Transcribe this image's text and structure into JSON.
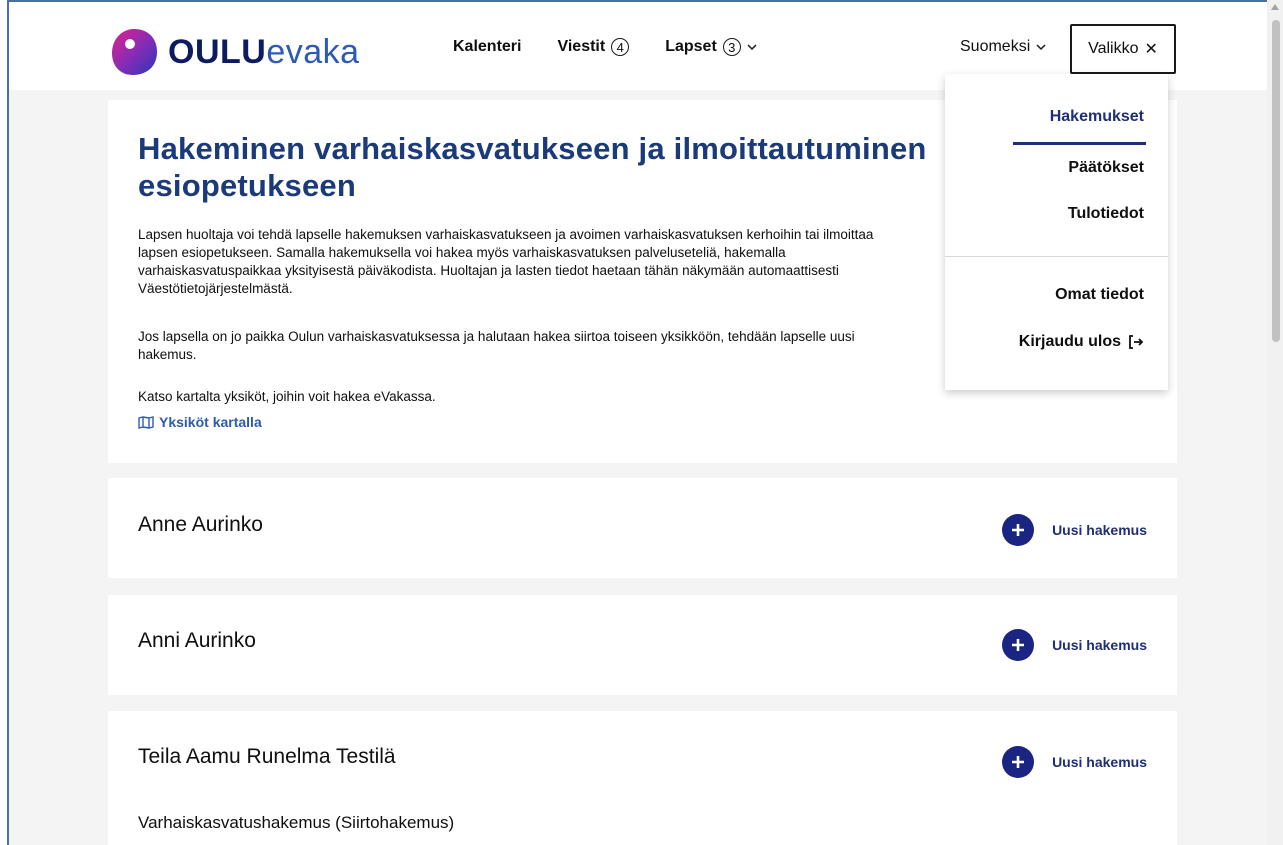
{
  "brand": {
    "part1": "OULU",
    "part2": "evaka"
  },
  "nav": {
    "calendar": "Kalenteri",
    "messages": "Viestit",
    "messages_count": "4",
    "children": "Lapset",
    "children_count": "3"
  },
  "header": {
    "language": "Suomeksi",
    "menu_label": "Valikko",
    "menu_close_glyph": "✕"
  },
  "menu": {
    "items": [
      {
        "label": "Hakemukset",
        "active": true
      },
      {
        "label": "Päätökset",
        "active": false
      },
      {
        "label": "Tulotiedot",
        "active": false
      }
    ],
    "account_items": [
      {
        "label": "Omat tiedot"
      },
      {
        "label": "Kirjaudu ulos"
      }
    ],
    "logout_icon": "sign-out-icon"
  },
  "intro": {
    "title": "Hakeminen varhaiskasvatukseen ja ilmoittautuminen esiopetukseen",
    "paragraph1": "Lapsen huoltaja voi tehdä lapselle hakemuksen varhaiskasvatukseen ja avoimen varhaiskasvatuksen kerhoihin tai ilmoittaa lapsen esiopetukseen. Samalla hakemuksella voi hakea myös varhaiskasvatuksen palveluseteliä, hakemalla varhaiskasvatuspaikkaa yksityisestä päiväkodista. Huoltajan ja lasten tiedot haetaan tähän näkymään automaattisesti Väestötietojärjestelmästä.",
    "paragraph2": "Jos lapsella on jo paikka Oulun varhaiskasvatuksessa ja halutaan hakea siirtoa toiseen yksikköön, tehdään lapselle uusi hakemus.",
    "paragraph3": "Katso kartalta yksiköt, joihin voit hakea eVakassa.",
    "map_link": "Yksiköt kartalla"
  },
  "children": [
    {
      "name": "Anne Aurinko",
      "action": "Uusi hakemus"
    },
    {
      "name": "Anni Aurinko",
      "action": "Uusi hakemus"
    },
    {
      "name": "Teila Aamu Runelma Testilä",
      "action": "Uusi hakemus",
      "application": "Varhaiskasvatushakemus (Siirtohakemus)"
    }
  ],
  "colors": {
    "brand_dark": "#0d1c5e",
    "brand_blue": "#2d5ab4",
    "accent": "#1a2583",
    "title": "#1a3a7a"
  }
}
